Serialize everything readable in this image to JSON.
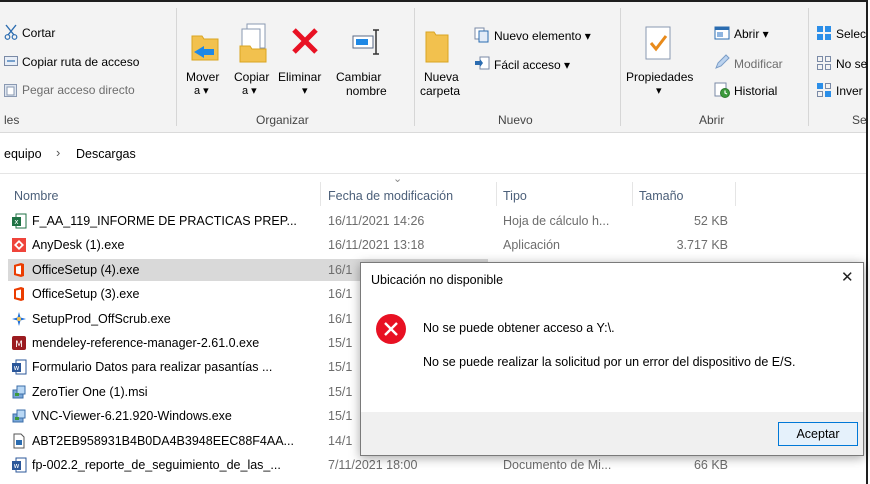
{
  "ribbon": {
    "clipboard": {
      "cut": "Cortar",
      "copy_path": "Copiar ruta de acceso",
      "paste_shortcut": "Pegar acceso directo",
      "group_label": "les"
    },
    "organize": {
      "move_line1": "Mover",
      "move_line2": "a ▾",
      "copy_line1": "Copiar",
      "copy_line2": "a ▾",
      "delete_line1": "Eliminar",
      "delete_line2": "▾",
      "rename_line1": "Cambiar",
      "rename_line2": "nombre",
      "group_label": "Organizar"
    },
    "new": {
      "new_folder_line1": "Nueva",
      "new_folder_line2": "carpeta",
      "new_item": "Nuevo elemento ▾",
      "easy_access": "Fácil acceso ▾",
      "group_label": "Nuevo"
    },
    "open": {
      "properties": "Propiedades",
      "properties_arrow": "▾",
      "open": "Abrir ▾",
      "edit": "Modificar",
      "history": "Historial",
      "group_label": "Abrir"
    },
    "select": {
      "select_all": "Selec",
      "select_none": "No se",
      "invert": "Inver",
      "group_label": "Se"
    }
  },
  "address": {
    "crumb1": "equipo",
    "sep": "›",
    "crumb2": "Descargas"
  },
  "columns": {
    "name": "Nombre",
    "date": "Fecha de modificación",
    "type": "Tipo",
    "size": "Tamaño",
    "sort_glyph": "⌄"
  },
  "files": [
    {
      "name": "F_AA_119_INFORME DE PRACTICAS PREP...",
      "date": "16/11/2021 14:26",
      "type": "Hoja de cálculo h...",
      "size": "52 KB",
      "icon": "excel-file-icon"
    },
    {
      "name": "AnyDesk (1).exe",
      "date": "16/11/2021 13:18",
      "type": "Aplicación",
      "size": "3.717 KB",
      "icon": "anydesk-icon"
    },
    {
      "name": "OfficeSetup (4).exe",
      "date": "16/1",
      "type": "",
      "size": "",
      "icon": "office-icon"
    },
    {
      "name": "OfficeSetup (3).exe",
      "date": "16/1",
      "type": "",
      "size": "",
      "icon": "office-icon"
    },
    {
      "name": "SetupProd_OffScrub.exe",
      "date": "16/1",
      "type": "",
      "size": "",
      "icon": "setup-icon"
    },
    {
      "name": "mendeley-reference-manager-2.61.0.exe",
      "date": "15/1",
      "type": "",
      "size": "",
      "icon": "mendeley-icon"
    },
    {
      "name": "Formulario Datos para realizar pasantías ...",
      "date": "15/1",
      "type": "",
      "size": "",
      "icon": "word-file-icon"
    },
    {
      "name": "ZeroTier One (1).msi",
      "date": "15/1",
      "type": "",
      "size": "",
      "icon": "installer-icon"
    },
    {
      "name": "VNC-Viewer-6.21.920-Windows.exe",
      "date": "15/1",
      "type": "",
      "size": "",
      "icon": "installer-icon"
    },
    {
      "name": "ABT2EB958931B4B0DA4B3948EEC88F4AA...",
      "date": "14/1",
      "type": "",
      "size": "",
      "icon": "generic-file-icon"
    },
    {
      "name": "fp-002.2_reporte_de_seguimiento_de_las_...",
      "date": "7/11/2021 18:00",
      "type": "Documento de Mi...",
      "size": "66 KB",
      "icon": "word-file-icon"
    }
  ],
  "dialog": {
    "title": "Ubicación no disponible",
    "close": "✕",
    "message1": "No se puede obtener acceso a Y:\\.",
    "message2": "No se puede realizar la solicitud por un error del dispositivo de E/S.",
    "ok_button": "Aceptar"
  },
  "colors": {
    "error_red": "#e81123",
    "delete_red": "#e81123",
    "selection": "#d9d9d9",
    "accent_blue": "#0078d7"
  }
}
